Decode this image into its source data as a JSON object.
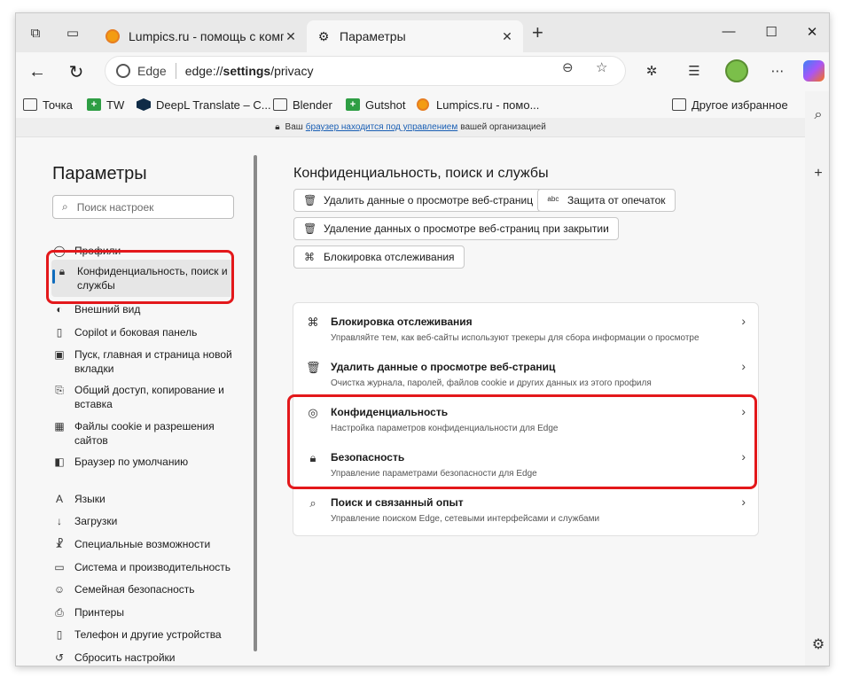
{
  "tabs": [
    {
      "title": "Lumpics.ru - помощь с компьюте",
      "active": false
    },
    {
      "title": "Параметры",
      "active": true
    }
  ],
  "address": {
    "site": "Edge",
    "url_prefix": "edge://",
    "url_host": "settings",
    "url_path": "/privacy"
  },
  "bookmarks": [
    {
      "label": "Точка",
      "icon": "folder-icon"
    },
    {
      "label": "TW",
      "icon": "tw-icon"
    },
    {
      "label": "DeepL Translate – C...",
      "icon": "deepl-icon"
    },
    {
      "label": "Blender",
      "icon": "folder-icon"
    },
    {
      "label": "Gutshot",
      "icon": "gutshot-icon"
    },
    {
      "label": "Lumpics.ru - помо...",
      "icon": "lumpics-icon"
    },
    {
      "label": "Другое избранное",
      "icon": "folder-icon"
    }
  ],
  "managed": {
    "prefix": "Ваш",
    "link": "браузер находится под управлением",
    "suffix": "вашей организацией"
  },
  "nav": {
    "title": "Параметры",
    "search_placeholder": "Поиск настроек",
    "items": [
      {
        "label": "Профили",
        "icon": "profile-icon"
      },
      {
        "label": "Конфиденциальность, поиск и службы",
        "icon": "lock-icon",
        "selected": true
      },
      {
        "label": "Внешний вид",
        "icon": "appearance-icon"
      },
      {
        "label": "Copilot и боковая панель",
        "icon": "sidebar-icon"
      },
      {
        "label": "Пуск, главная и страница новой вкладки",
        "icon": "start-icon"
      },
      {
        "label": "Общий доступ, копирование и вставка",
        "icon": "share-icon"
      },
      {
        "label": "Файлы cookie и разрешения сайтов",
        "icon": "cookie-icon"
      },
      {
        "label": "Браузер по умолчанию",
        "icon": "default-browser-icon"
      },
      {
        "label": "Языки",
        "icon": "languages-icon"
      },
      {
        "label": "Загрузки",
        "icon": "download-icon"
      },
      {
        "label": "Специальные возможности",
        "icon": "accessibility-icon"
      },
      {
        "label": "Система и производительность",
        "icon": "system-icon"
      },
      {
        "label": "Семейная безопасность",
        "icon": "family-icon"
      },
      {
        "label": "Принтеры",
        "icon": "printer-icon"
      },
      {
        "label": "Телефон и другие устройства",
        "icon": "phone-icon"
      },
      {
        "label": "Сбросить настройки",
        "icon": "reset-icon"
      }
    ]
  },
  "main": {
    "title": "Конфиденциальность, поиск и службы",
    "chips": [
      {
        "label": "Удалить данные о просмотре веб-страниц",
        "icon": "trash-icon"
      },
      {
        "label": "Защита от опечаток",
        "icon": "typo-icon"
      },
      {
        "label": "Удаление данных о просмотре веб-страниц при закрытии",
        "icon": "trash-clock-icon"
      },
      {
        "label": "Блокировка отслеживания",
        "icon": "tracking-icon"
      }
    ],
    "rows": [
      {
        "title": "Блокировка отслеживания",
        "desc": "Управляйте тем, как веб-сайты используют трекеры для сбора информации о просмотре",
        "icon": "tracking-icon"
      },
      {
        "title": "Удалить данные о просмотре веб-страниц",
        "desc": "Очистка журнала, паролей, файлов cookie и других данных из этого профиля",
        "icon": "trash-icon"
      },
      {
        "title": "Конфиденциальность",
        "desc": "Настройка параметров конфиденциальности для Edge",
        "icon": "privacy-icon"
      },
      {
        "title": "Безопасность",
        "desc": "Управление параметрами безопасности для Edge",
        "icon": "security-icon"
      },
      {
        "title": "Поиск и связанный опыт",
        "desc": "Управление поиском Edge, сетевыми интерфейсами и службами",
        "icon": "search-icon"
      }
    ]
  },
  "colors": {
    "highlight": "#e3181b",
    "accent": "#0f6cbd"
  }
}
